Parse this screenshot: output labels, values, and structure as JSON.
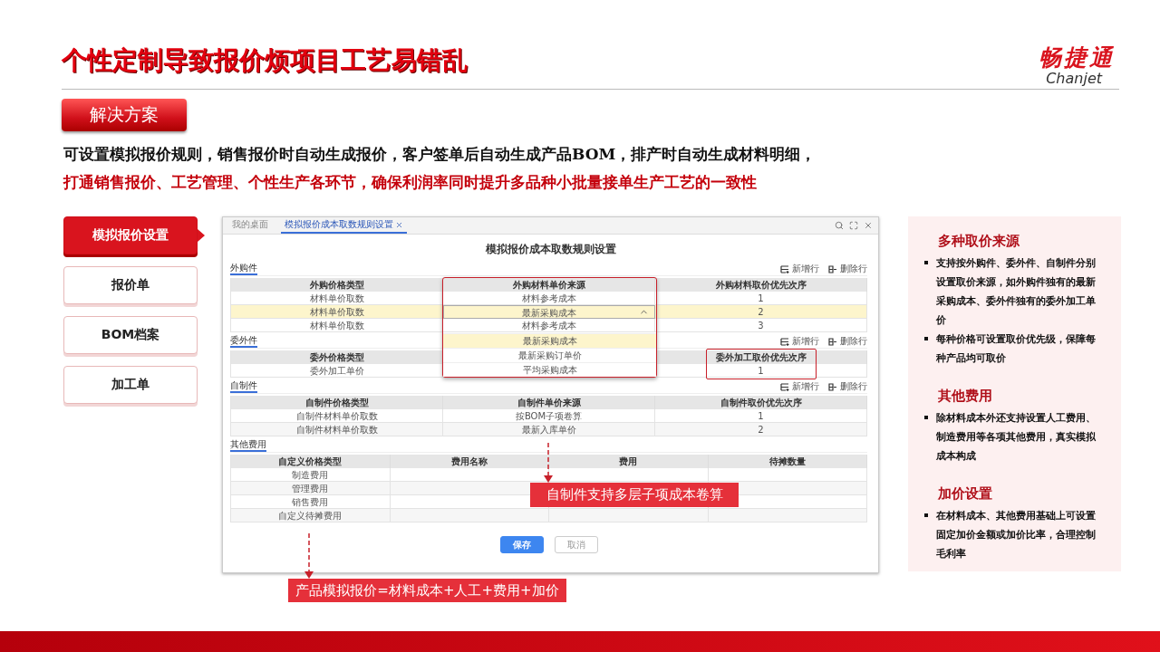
{
  "title": "个性定制导致报价烦项目工艺易错乱",
  "logo": {
    "name": "畅捷通",
    "latin": "Chanjet"
  },
  "tag": "解决方案",
  "intro": [
    {
      "text": "可设置模拟报价规则，销售报价时自动生成报价，客户签单后自动生成产品BOM，排产时自动生成材料明细，",
      "emphasis": false
    },
    {
      "text": "打通销售报价、工艺管理、个性生产各环节，确保利润率同时提升多品种小批量接单生产工艺的一致性",
      "emphasis": true
    }
  ],
  "nav": [
    {
      "label": "模拟报价设置",
      "selected": true
    },
    {
      "label": "报价单",
      "selected": false
    },
    {
      "label": "BOM档案",
      "selected": false
    },
    {
      "label": "加工单",
      "selected": false
    }
  ],
  "window": {
    "tabs": [
      {
        "label": "我的桌面",
        "selected": false
      },
      {
        "label": "模拟报价成本取数规则设置",
        "selected": true
      }
    ],
    "heading": "模拟报价成本取数规则设置",
    "sections": [
      {
        "label": "外购件",
        "actions": [
          "新增行",
          "删除行"
        ],
        "columns": [
          {
            "label": "外购价格类型"
          },
          {
            "label": "外购材料单价来源"
          },
          {
            "label": "外购材料取价优先次序"
          }
        ],
        "rows": [
          {
            "cells": [
              "材料单价取数",
              "材料参考成本",
              "1"
            ],
            "selected": false
          },
          {
            "cells": [
              "材料单价取数",
              "最新采购成本",
              "2"
            ],
            "selected": true,
            "dropdown": {
              "expanded": true,
              "options": [
                {
                  "label": "最新采购成本",
                  "selected": true
                },
                {
                  "label": "最新采购订单价",
                  "selected": false
                },
                {
                  "label": "平均采购成本",
                  "selected": false
                }
              ]
            }
          },
          {
            "cells": [
              "材料单价取数",
              "材料参考成本",
              "3"
            ],
            "selected": false
          }
        ]
      },
      {
        "label": "委外件",
        "actions": [
          "新增行",
          "删除行"
        ],
        "columns": [
          {
            "label": "委外价格类型"
          },
          {},
          {
            "label": "委外加工取价优先次序",
            "outlined": true
          }
        ],
        "rows": [
          {
            "cells": [
              "委外加工单价",
              null,
              "1"
            ],
            "selected": false
          }
        ]
      },
      {
        "label": "自制件",
        "actions": [
          "新增行",
          "删除行"
        ],
        "columns": [
          {
            "label": "自制件价格类型"
          },
          {
            "label": "自制件单价来源"
          },
          {
            "label": "自制件取价优先次序"
          }
        ],
        "rows": [
          {
            "cells": [
              "自制件材料单价取数",
              "按BOM子项卷算",
              "1"
            ],
            "selected": false
          },
          {
            "cells": [
              "自制件材料单价取数",
              "最新入库单价",
              "2"
            ],
            "selected": false
          }
        ]
      },
      {
        "label": "其他费用",
        "columns": [
          {
            "label": "自定义价格类型"
          },
          {
            "label": "费用名称"
          },
          {
            "label": "费用"
          },
          {
            "label": "待摊数量"
          }
        ],
        "rows": [
          {
            "cells": [
              "制造费用",
              null,
              null,
              null
            ],
            "selected": false
          },
          {
            "cells": [
              "管理费用",
              null,
              null,
              null
            ],
            "selected": false
          },
          {
            "cells": [
              "销售费用",
              null,
              null,
              null
            ],
            "selected": false
          },
          {
            "cells": [
              "自定义待摊费用",
              null,
              null,
              null
            ],
            "selected": false
          }
        ]
      }
    ],
    "buttons": [
      {
        "label": "保存",
        "kind": "primary"
      },
      {
        "label": "取消",
        "kind": "secondary"
      }
    ]
  },
  "callouts": [
    "自制件支持多层子项成本卷算",
    "产品模拟报价=材料成本+人工+费用+加价"
  ],
  "notes": [
    {
      "heading": "多种取价来源",
      "bullets": [
        "支持按外购件、委外件、自制件分别设置取价来源，如外购件独有的最新采购成本、委外件独有的委外加工单价",
        "每种价格可设置取价优先级，保障每种产品均可取价"
      ]
    },
    {
      "heading": "其他费用",
      "bullets": [
        "除材料成本外还支持设置人工费用、制造费用等各项其他费用，真实模拟成本构成"
      ]
    },
    {
      "heading": "加价设置",
      "bullets": [
        "在材料成本、其他费用基础上可设置固定加价金额或加价比率，合理控制毛利率"
      ]
    }
  ]
}
